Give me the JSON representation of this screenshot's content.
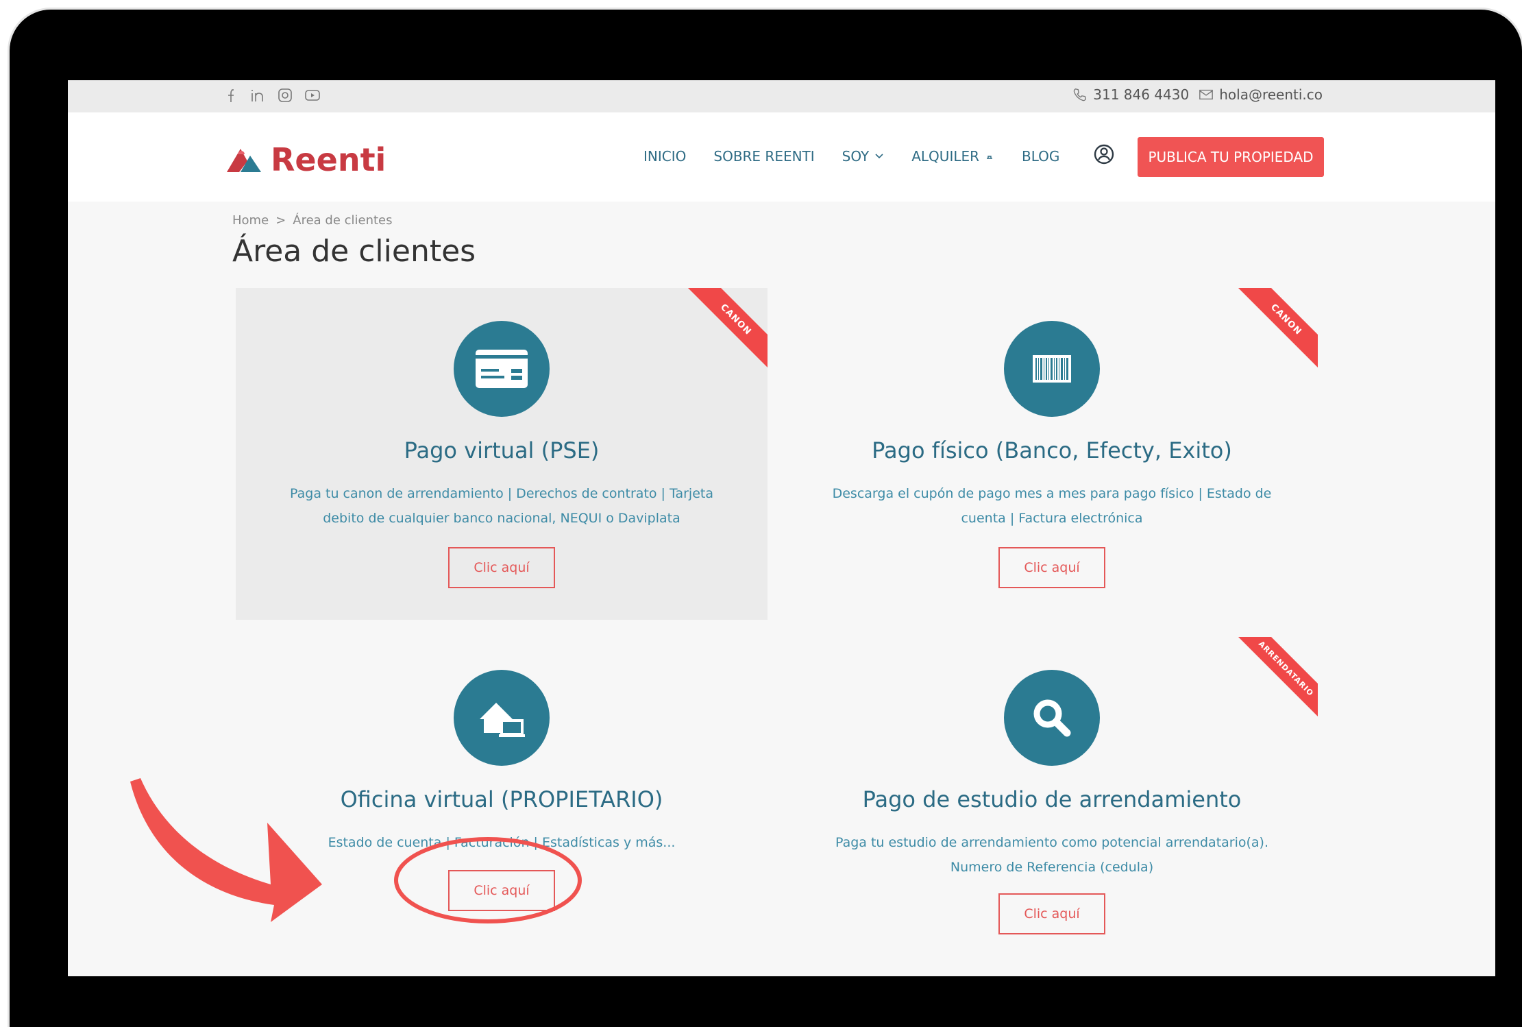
{
  "topbar": {
    "social_icons": [
      "facebook-icon",
      "linkedin-icon",
      "instagram-icon",
      "youtube-icon"
    ],
    "phone": "311 846 4430",
    "email": "hola@reenti.co"
  },
  "header": {
    "logo_text": "Reenti",
    "nav": [
      "INICIO",
      "SOBRE REENTI",
      "SOY",
      "ALQUILER",
      "BLOG"
    ],
    "cta": "PUBLICA TU PROPIEDAD"
  },
  "breadcrumb": {
    "home": "Home",
    "separator": ">",
    "current": "Área de clientes"
  },
  "page_title": "Área de clientes",
  "cards": [
    {
      "icon": "credit-card-icon",
      "title": "Pago virtual (PSE)",
      "desc1": "Paga tu canon de arrendamiento | Derechos de contrato | Tarjeta",
      "desc2": "debito de cualquier banco nacional, NEQUI o Daviplata",
      "button": "Clic aquí",
      "ribbon": "CANON"
    },
    {
      "icon": "barcode-icon",
      "title": "Pago físico (Banco, Efecty, Exito)",
      "desc1": "Descarga el cupón de pago mes a mes para pago físico | Estado de",
      "desc2": "cuenta | Factura electrónica",
      "button": "Clic aquí",
      "ribbon": "CANON"
    },
    {
      "icon": "home-office-icon",
      "title": "Oficina virtual (PROPIETARIO)",
      "desc1": "Estado de cuenta | Facturación | Estadísticas y más...",
      "desc2": "",
      "button": "Clic aquí",
      "ribbon": ""
    },
    {
      "icon": "magnifier-icon",
      "title": "Pago de estudio de arrendamiento",
      "desc1": "Paga tu estudio de arrendamiento como potencial arrendatario(a).",
      "desc2": "Numero de Referencia (cedula)",
      "button": "Clic aquí",
      "ribbon": "ARRENDATARIO"
    }
  ],
  "colors": {
    "accent": "#f05454",
    "teal": "#2b7b92",
    "title": "#2b6b84",
    "annotation": "#f0524f"
  }
}
